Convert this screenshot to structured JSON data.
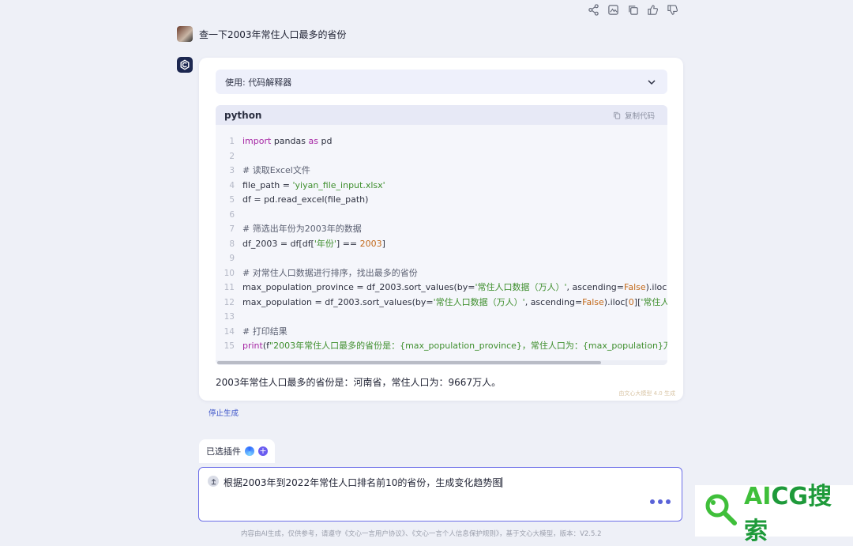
{
  "top_actions": {
    "icons": [
      "share-icon",
      "image-icon",
      "copy-icon",
      "thumbs-up-icon",
      "thumbs-down-icon"
    ]
  },
  "user_message": {
    "text": "查一下2003年常住人口最多的省份"
  },
  "response": {
    "plugin_header": "使用: 代码解释器",
    "code": {
      "language": "python",
      "copy_label": "复制代码",
      "line_numbers": [
        "1",
        "2",
        "3",
        "4",
        "5",
        "6",
        "7",
        "8",
        "9",
        "10",
        "11",
        "12",
        "13",
        "14",
        "15"
      ]
    },
    "answer": "2003年常住人口最多的省份是：河南省，常住人口为：9667万人。",
    "generated_by": "由文心大模型 4.0 生成"
  },
  "stop_generating": "停止生成",
  "plugins": {
    "label": "已选插件"
  },
  "input": {
    "value": "根据2003年到2022年常住人口排名前10的省份，生成变化趋势图"
  },
  "footer": "内容由AI生成，仅供参考，请遵守《文心一言用户协议》、《文心一言个人信息保护规则》，基于文心大模型，版本：V2.5.2",
  "watermark": {
    "text_ai": "AI",
    "text_cg": "CG",
    "text_cn": "搜索"
  },
  "colors": {
    "accent": "#6c6ee8",
    "link": "#3c53c8",
    "keyword": "#a626a4",
    "string": "#3f8f2e",
    "number": "#c2691a"
  }
}
